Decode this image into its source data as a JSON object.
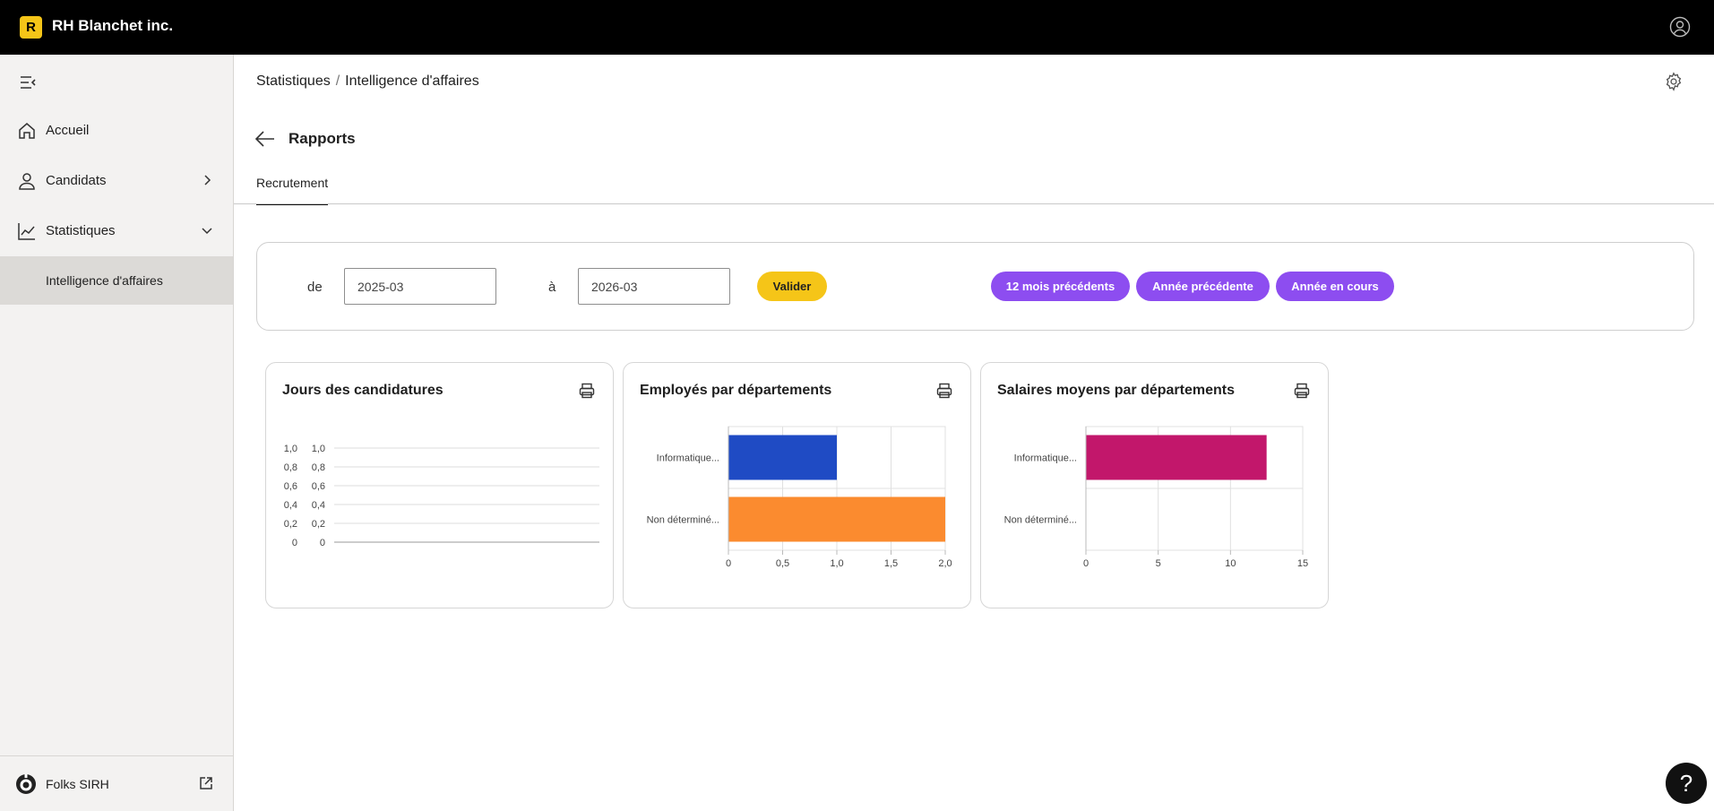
{
  "app": {
    "logo_letter": "R",
    "brand": "RH Blanchet inc."
  },
  "sidebar": {
    "items": [
      {
        "label": "Accueil",
        "icon": "home-icon"
      },
      {
        "label": "Candidats",
        "icon": "user-icon"
      },
      {
        "label": "Statistiques",
        "icon": "chart-line-icon"
      }
    ],
    "subitem": "Intelligence d'affaires",
    "footer": "Folks SIRH"
  },
  "breadcrumb": {
    "first": "Statistiques",
    "separator": "/",
    "current": "Intelligence d'affaires"
  },
  "page": {
    "title": "Rapports",
    "tab": "Recrutement"
  },
  "filter": {
    "from_label": "de",
    "from_value": "2025-03",
    "to_label": "à",
    "to_value": "2026-03",
    "validate": "Valider",
    "presets": [
      "12 mois précédents",
      "Année précédente",
      "Année en cours"
    ]
  },
  "colors": {
    "accent_yellow": "#f5c518",
    "accent_purple": "#8d4df0",
    "bar_blue": "#1f4bc4",
    "bar_orange": "#fb8b2f",
    "bar_magenta": "#c2176b"
  },
  "charts": [
    {
      "title": "Jours des candidatures"
    },
    {
      "title": "Employés par départements"
    },
    {
      "title": "Salaires moyens par départements"
    }
  ],
  "chart_data": [
    {
      "type": "line",
      "title": "Jours des candidatures",
      "yticks_left": [
        "1,0",
        "0,8",
        "0,6",
        "0,4",
        "0,2",
        "0"
      ],
      "yticks_right": [
        "1,0",
        "0,8",
        "0,6",
        "0,4",
        "0,2",
        "0"
      ],
      "ylim": [
        0,
        1
      ],
      "series": []
    },
    {
      "type": "bar",
      "orientation": "horizontal",
      "title": "Employés par départements",
      "categories": [
        "Informatique...",
        "Non déterminé..."
      ],
      "values": [
        1,
        2
      ],
      "colors": [
        "#1f4bc4",
        "#fb8b2f"
      ],
      "xticks": [
        "0",
        "0,5",
        "1,0",
        "1,5",
        "2,0"
      ],
      "xlim": [
        0,
        2
      ]
    },
    {
      "type": "bar",
      "orientation": "horizontal",
      "title": "Salaires moyens par départements",
      "categories": [
        "Informatique...",
        "Non déterminé..."
      ],
      "values": [
        12.5,
        0
      ],
      "colors": [
        "#c2176b",
        "#c2176b"
      ],
      "xticks": [
        "0",
        "5",
        "10",
        "15"
      ],
      "xlim": [
        0,
        15
      ]
    }
  ],
  "help": "?"
}
